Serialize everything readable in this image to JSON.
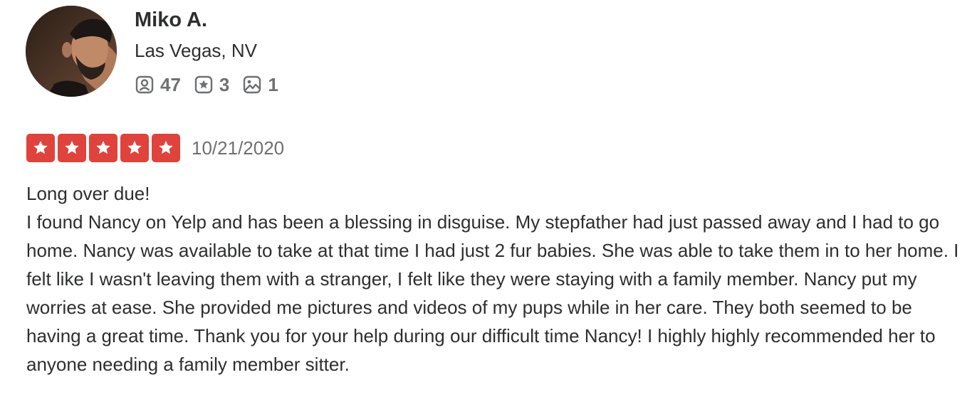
{
  "user": {
    "name": "Miko A.",
    "location": "Las Vegas, NV",
    "stats": {
      "friends": "47",
      "reviews": "3",
      "photos": "1"
    }
  },
  "review": {
    "rating": 5,
    "rating_max": 5,
    "date": "10/21/2020",
    "title_line": "Long over due!",
    "body": "I found Nancy on Yelp and has been a blessing in disguise. My stepfather had just passed away and I had to go home. Nancy was available to take at that time I had just 2 fur babies. She was able to take them in to her home. I felt like I wasn't leaving them with a stranger, I felt like they were staying with a family member. Nancy put my worries at ease. She provided me pictures and videos of my pups while in her care. They both seemed to be having a great time. Thank you for your help during our difficult time Nancy! I highly highly recommended her to anyone needing a family member sitter."
  },
  "icons": {
    "friends": "friends-icon",
    "reviews": "reviews-icon",
    "photos": "photos-icon",
    "star": "star-icon"
  },
  "colors": {
    "star_background": "#e0423c",
    "text_primary": "#2d2e2f",
    "text_secondary": "#6e7072"
  }
}
